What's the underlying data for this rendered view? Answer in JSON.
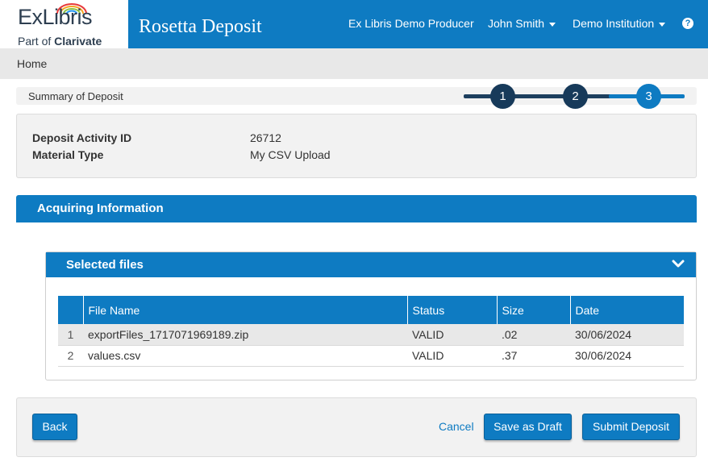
{
  "header": {
    "logo_main": "ExLibris",
    "logo_sub_prefix": "Part of ",
    "logo_sub_brand": "Clarivate",
    "app_title": "Rosetta Deposit",
    "producer": "Ex Libris Demo Producer",
    "user": "John Smith",
    "institution": "Demo Institution",
    "help_label": "?"
  },
  "breadcrumb": {
    "home": "Home"
  },
  "steps": {
    "label": "Summary of Deposit",
    "items": [
      "1",
      "2",
      "3"
    ],
    "current": 3
  },
  "deposit_info": {
    "activity_id_label": "Deposit Activity ID",
    "activity_id_value": "26712",
    "material_type_label": "Material Type",
    "material_type_value": "My CSV Upload"
  },
  "acquiring": {
    "title": "Acquiring Information"
  },
  "selected_files": {
    "title": "Selected files",
    "columns": [
      "",
      "File Name",
      "Status",
      "Size",
      "Date"
    ],
    "rows": [
      {
        "num": "1",
        "file_name": "exportFiles_1717071969189.zip",
        "status": "VALID",
        "size": ".02",
        "date": "30/06/2024"
      },
      {
        "num": "2",
        "file_name": "values.csv",
        "status": "VALID",
        "size": ".37",
        "date": "30/06/2024"
      }
    ]
  },
  "actions": {
    "back": "Back",
    "cancel": "Cancel",
    "save_draft": "Save as Draft",
    "submit": "Submit Deposit"
  },
  "colors": {
    "primary": "#0e7bc2",
    "step_done": "#173a5a",
    "panel_bg": "#f2f2f2"
  }
}
